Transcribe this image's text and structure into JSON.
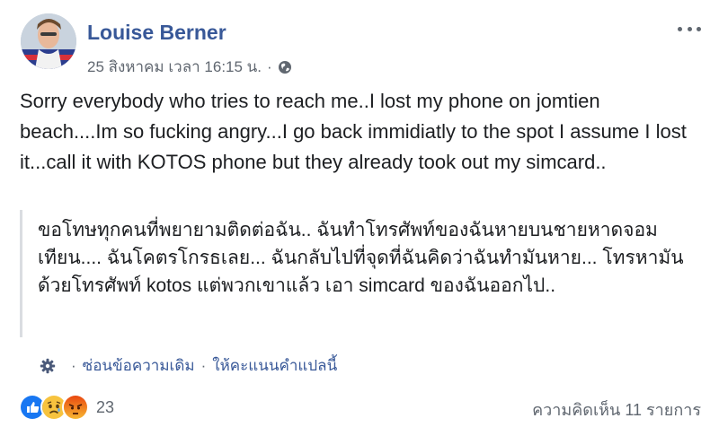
{
  "post": {
    "author": "Louise Berner",
    "timestamp": "25 สิงหาคม เวลา 16:15 น.",
    "privacy_icon": "globe-icon",
    "body": "Sorry everybody who tries to reach me..I lost my phone on jomtien beach....Im so fucking angry...I go back immidiatly to the spot I assume I lost it...call it with KOTOS phone but they already took out my simcard..",
    "translation": "ขอโทษทุกคนที่พยายามติดต่อฉัน.. ฉันทำโทรศัพท์ของฉันหายบนชายหาดจอมเทียน.... ฉันโคตรโกรธเลย... ฉันกลับไปที่จุดที่ฉันคิดว่าฉันทำมันหาย... โทรหามันด้วยโทรศัพท์ kotos แต่พวกเขาแล้ว เอา simcard ของฉันออกไป..",
    "hide_original": "ซ่อนข้อความเดิม",
    "rate_translation": "ให้คะแนนคำแปลนี้",
    "separator": "·",
    "reactions": [
      "like-icon",
      "sad-icon",
      "angry-icon"
    ],
    "reaction_count": "23",
    "comments": "ความคิดเห็น 11 รายการ"
  },
  "colors": {
    "author_link": "#385898",
    "secondary_text": "#606770",
    "like": "#1877f2",
    "sad": "#f7c33e",
    "angry": "#e9710f"
  }
}
